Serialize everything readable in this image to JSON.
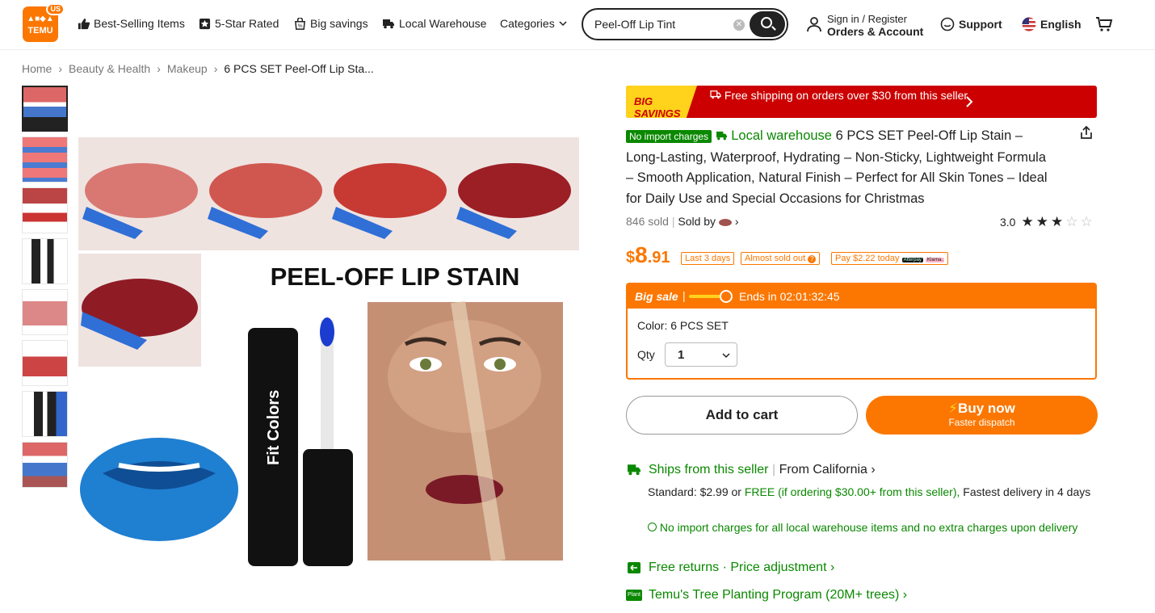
{
  "header": {
    "logo_text": "TEMU",
    "logo_region": "US",
    "nav": [
      {
        "label": "Best-Selling Items",
        "icon": "thumbs-up-icon"
      },
      {
        "label": "5-Star Rated",
        "icon": "star-badge-icon"
      },
      {
        "label": "Big savings",
        "icon": "bag-percent-icon"
      },
      {
        "label": "Local Warehouse",
        "icon": "truck-icon"
      },
      {
        "label": "Categories",
        "icon": "chevron-down-icon"
      }
    ],
    "search_value": "Peel-Off Lip Tint",
    "account_line1": "Sign in / Register",
    "account_line2": "Orders & Account",
    "support": "Support",
    "language": "English"
  },
  "breadcrumb": [
    "Home",
    "Beauty & Health",
    "Makeup",
    "6 PCS SET Peel-Off Lip Sta..."
  ],
  "main_image": {
    "headline": "PEEL-OFF LIP STAIN",
    "brand": "Fit Colors"
  },
  "product": {
    "banner_tag": "BIG SAVINGS",
    "banner_text": "Free shipping on orders over $30 from this seller",
    "no_import": "No import charges",
    "local_warehouse": "Local warehouse",
    "title": "6 PCS SET Peel-Off Lip Stain – Long-Lasting, Waterproof, Hydrating – Non-Sticky, Lightweight Formula – Smooth Application, Natural Finish – Perfect for All Skin Tones – Ideal for Daily Use and Special Occasions for Christmas",
    "sold": "846 sold",
    "sold_by": "Sold by",
    "rating": "3.0",
    "rating_value": 3,
    "price_dollar": "$",
    "price_int": "8",
    "price_dec": ".91",
    "tag_last": "Last 3 days",
    "tag_almost": "Almost sold out",
    "tag_pay": "Pay $2.22 today",
    "tag_afterpay": "Afterpay",
    "tag_klarna": "Klarna.",
    "big_sale": "Big sale",
    "ends_in": "Ends in 02:01:32:45",
    "color_label": "Color: 6 PCS SET",
    "qty_label": "Qty",
    "qty_value": "1",
    "add_to_cart": "Add to cart",
    "buy_now": "Buy now",
    "buy_sub": "Faster dispatch"
  },
  "shipping": {
    "ships_from": "Ships from this seller",
    "from_loc": "From California",
    "standard_label": "Standard: $2.99 or",
    "free_text": "FREE (if ordering $30.00+ from this seller),",
    "delivery_text": "Fastest delivery in 4 days",
    "no_import_line": "No import charges for all local warehouse items and no extra charges upon delivery",
    "free_returns": "Free returns · Price adjustment",
    "tree": "Temu's Tree Planting Program (20M+ trees)",
    "tree_badge": "Plant"
  },
  "colors": {
    "accent": "#fb7701",
    "green": "#0a8800",
    "red": "#cc0000"
  }
}
